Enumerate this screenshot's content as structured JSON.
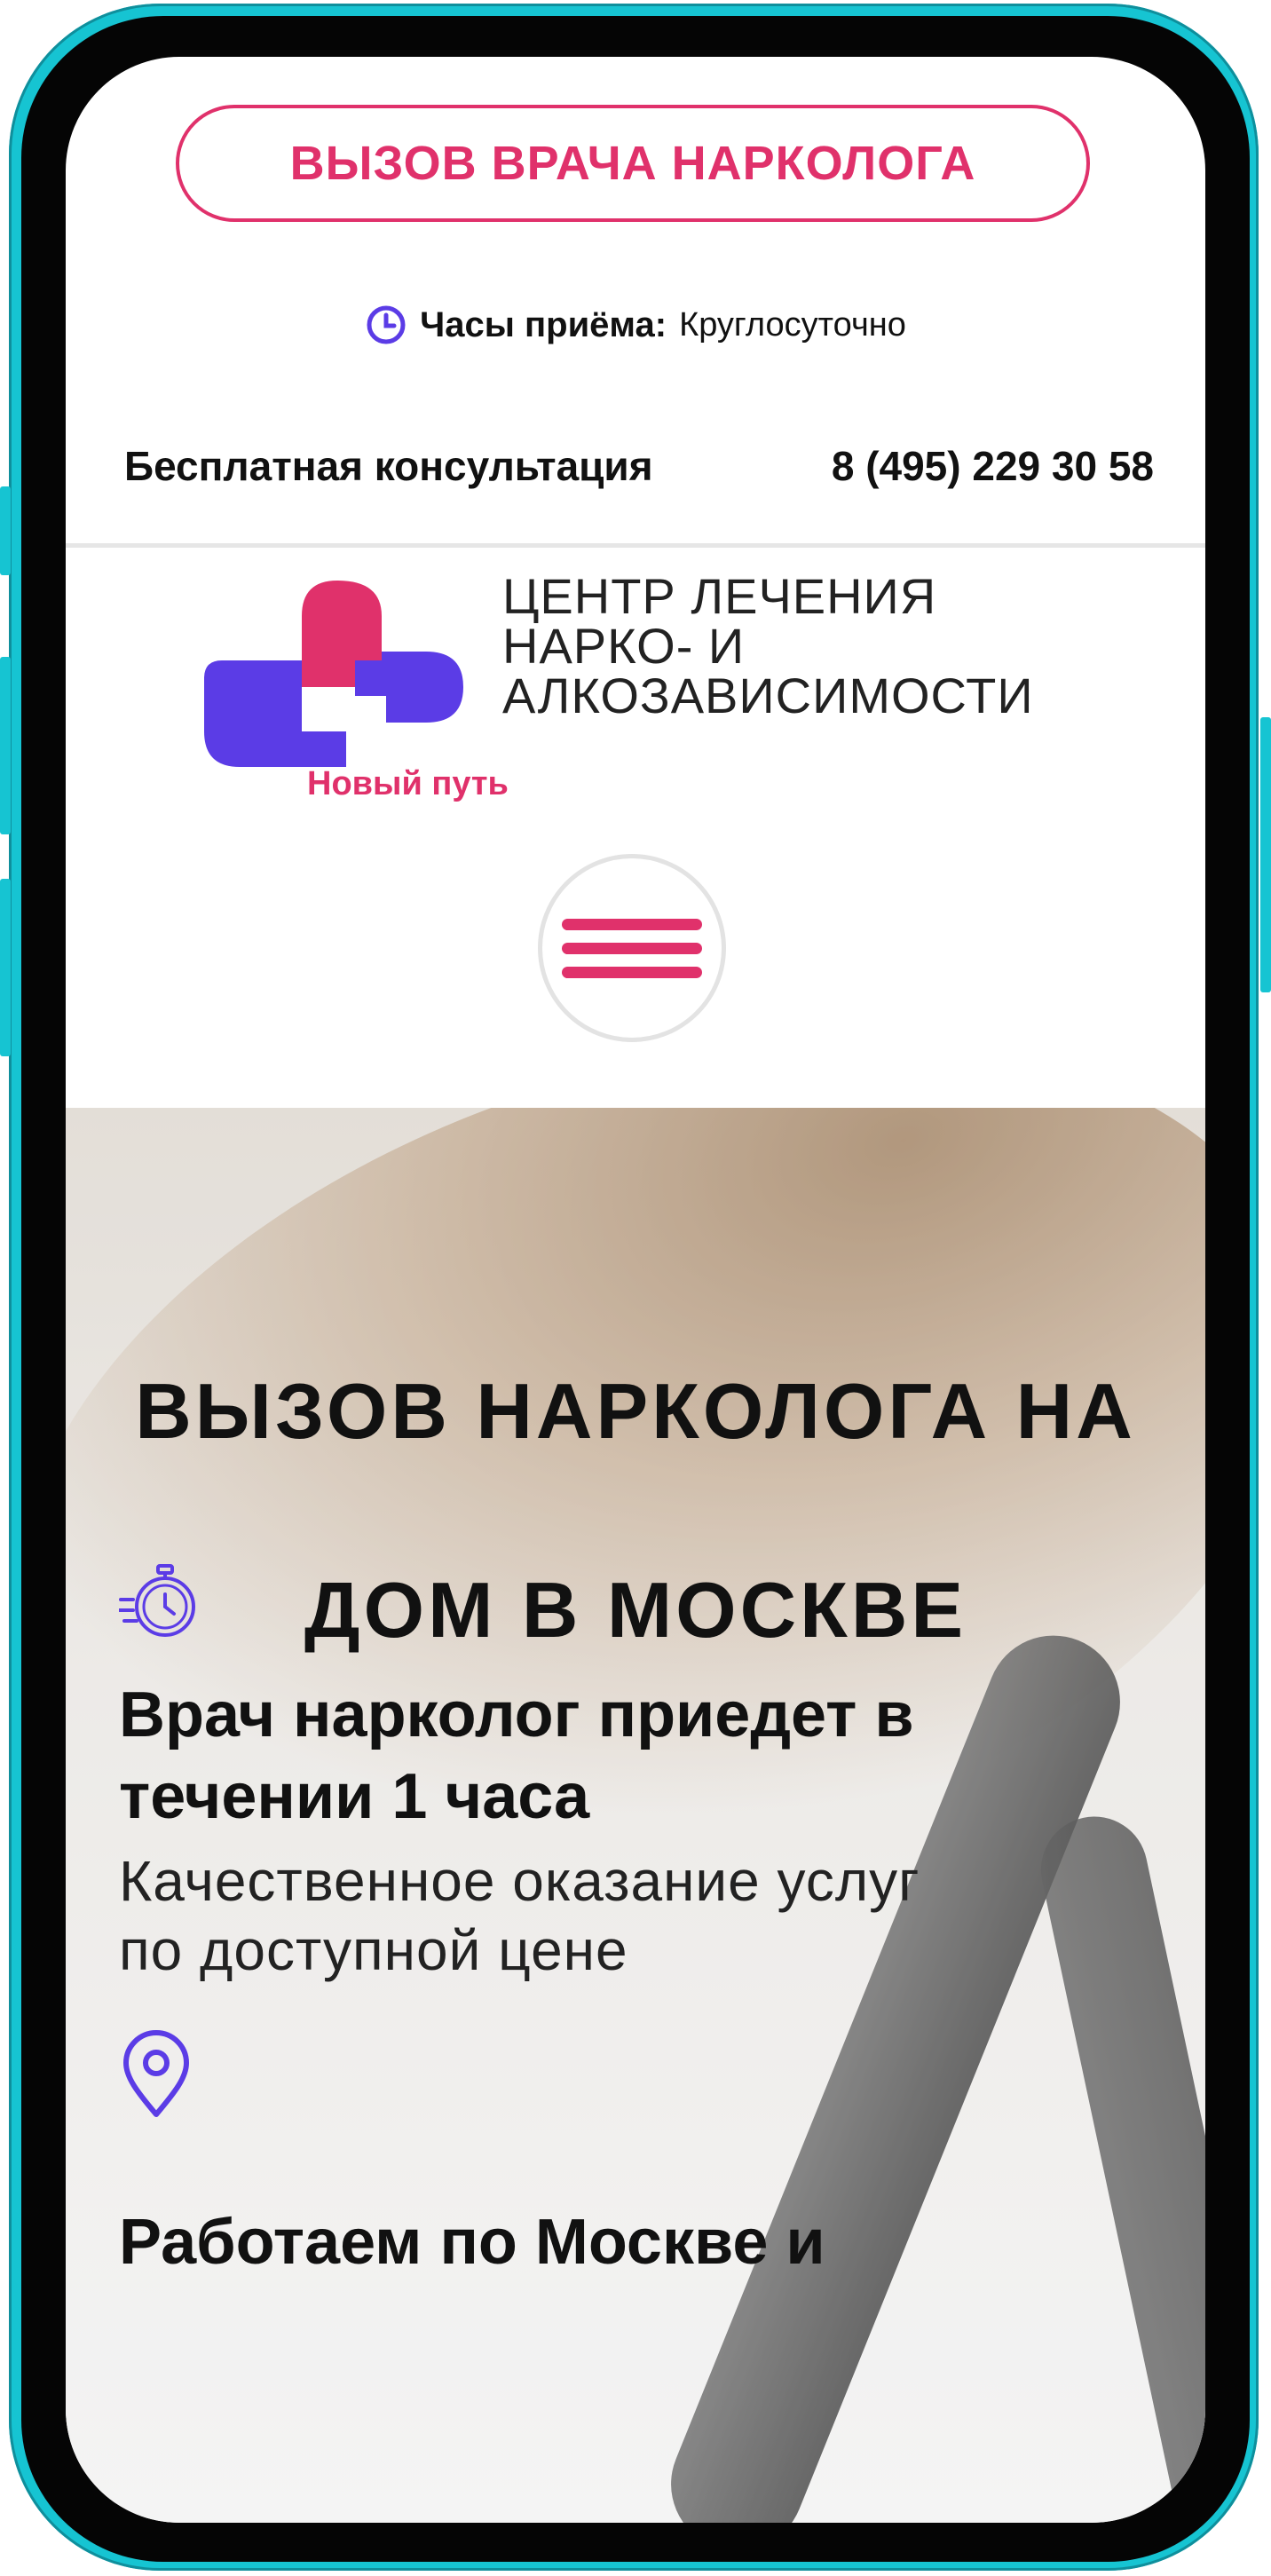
{
  "header": {
    "call_button": "ВЫЗОВ ВРАЧА НАРКОЛОГА",
    "hours_label": "Часы приёма:",
    "hours_value": "Круглосуточно",
    "consult_label": "Бесплатная консультация",
    "phone": "8 (495) 229 30 58"
  },
  "brand": {
    "title_line1": "ЦЕНТР ЛЕЧЕНИЯ",
    "title_line2": "НАРКО- И",
    "title_line3": "АЛКОЗАВИСИМОСТИ",
    "subtitle": "Новый путь"
  },
  "hero": {
    "title_line1": "ВЫЗОВ НАРКОЛОГА НА",
    "title_line2": "ДОМ В МОСКВЕ",
    "features": [
      {
        "icon": "stopwatch-icon",
        "title_line1": "Врач нарколог приедет в",
        "title_line2": "течении 1 часа",
        "text_line1": "Качественное оказание услуг",
        "text_line2": "по доступной цене"
      },
      {
        "icon": "location-pin-icon",
        "title": "Работаем по Москве и"
      }
    ]
  },
  "colors": {
    "accent_pink": "#e0316b",
    "accent_violet": "#5b3ce6",
    "phone_frame": "#16c4d2"
  }
}
